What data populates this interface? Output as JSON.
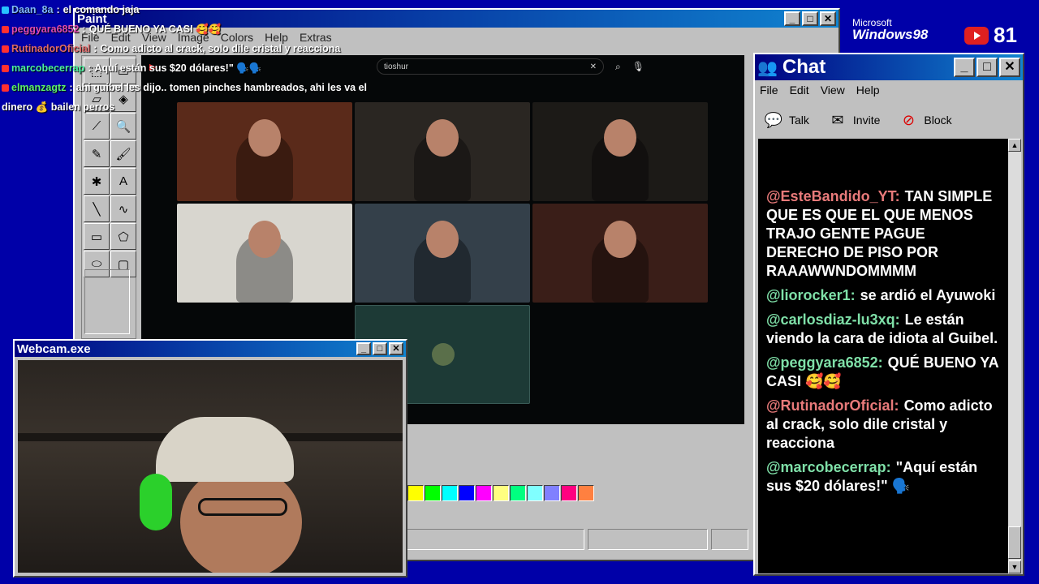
{
  "overlay_chat": [
    {
      "user": "Daan_8a",
      "sep": ":",
      "text": "el comando jaja",
      "user_color": "#7fb7ff",
      "badge_color": "#27c2ff"
    },
    {
      "user": "peggyara6852",
      "sep": ":",
      "text": "QUÉ BUENO YA CASI 🥰🥰",
      "user_color": "#e04cae",
      "badge_color": "#ff3030"
    },
    {
      "user": "RutinadorOficial",
      "sep": ":",
      "text": "Como adicto al crack, solo dile cristal y reacciona",
      "user_color": "#e06a6a",
      "badge_color": "#ff3030"
    },
    {
      "user": "marcobecerrap",
      "sep": ":",
      "text": "Aquí están sus $20 dólares!\" 🗣️🗣️",
      "user_color": "#4cf0a0",
      "badge_color": "#ff3030"
    },
    {
      "user": "elmanzagtz",
      "sep": ":",
      "text": "ahi guibel les dijo.. tomen pinches hambreados, ahi les va el",
      "user_color": "#5cf06a",
      "badge_color": "#ff3030"
    },
    {
      "user": "",
      "sep": "",
      "text": "dinero 💰 bailen perros",
      "user_color": "#ffffff",
      "badge_color": ""
    }
  ],
  "paint": {
    "title": "Paint",
    "menu": [
      "File",
      "Edit",
      "View",
      "Image",
      "Colors",
      "Help",
      "Extras"
    ],
    "tools": [
      "free-select",
      "rect-select",
      "eraser",
      "fill",
      "eyedropper",
      "magnifier",
      "pencil",
      "brush",
      "airbrush",
      "text",
      "line",
      "curve",
      "rectangle",
      "polygon",
      "ellipse",
      "rounded-rect"
    ],
    "tool_glyphs": [
      "⬚",
      "▭",
      "▱",
      "◈",
      "⟋",
      "🔍",
      "✎",
      "🖌",
      "✱",
      "A",
      "╲",
      "∿",
      "▭",
      "⬠",
      "⬭",
      "▢"
    ],
    "palette": [
      "#ffff00",
      "#00ff00",
      "#00ffff",
      "#0000ff",
      "#ff00ff",
      "#ffff80",
      "#00ff80",
      "#80ffff",
      "#8080ff",
      "#ff0080",
      "#ff8040"
    ],
    "youtube": {
      "search_value": "tioshur"
    },
    "cams": [
      {
        "bg": "#5a2a1a"
      },
      {
        "bg": "#2a2622"
      },
      {
        "bg": "#1c1a17"
      },
      {
        "bg": "#d8d6cf"
      },
      {
        "bg": "#34404a"
      },
      {
        "bg": "#3a1e18"
      },
      {
        "bg": "#1d3a36"
      }
    ]
  },
  "branding": {
    "ms": "Microsoft",
    "win98": "Windows98",
    "viewer_count": "81"
  },
  "chat_window": {
    "title": "Chat",
    "menu": [
      "File",
      "Edit",
      "View",
      "Help"
    ],
    "tools": [
      {
        "label": "Talk",
        "icon": "talk-icon"
      },
      {
        "label": "Invite",
        "icon": "invite-icon"
      },
      {
        "label": "Block",
        "icon": "block-icon"
      }
    ],
    "messages": [
      {
        "user": "@EsteBandido_YT:",
        "text": "TAN SIMPLE QUE ES QUE EL QUE MENOS TRAJO GENTE PAGUE DERECHO DE PISO POR RAAAWWNDOMMMM",
        "color": "#e87a7a"
      },
      {
        "user": "@liorocker1:",
        "text": "se ardió el Ayuwoki",
        "color": "#7fe0a8"
      },
      {
        "user": "@carlosdiaz-lu3xq:",
        "text": "Le están viendo la cara de idiota al Guibel.",
        "color": "#7fe0a8"
      },
      {
        "user": "@peggyara6852:",
        "text": "QUÉ BUENO YA CASI 🥰🥰",
        "color": "#7fe0a8"
      },
      {
        "user": "@RutinadorOficial:",
        "text": "Como adicto al crack, solo dile cristal y reacciona",
        "color": "#e87a7a"
      },
      {
        "user": "@marcobecerrap:",
        "text": "\"Aquí están sus $20 dólares!\" 🗣️",
        "color": "#7fe0a8"
      }
    ]
  },
  "webcam": {
    "title": "Webcam.exe"
  }
}
